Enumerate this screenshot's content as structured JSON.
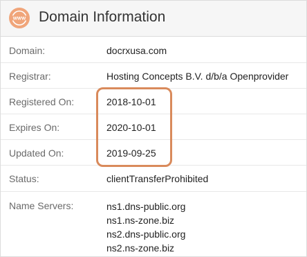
{
  "header": {
    "icon": "www-globe-icon",
    "icon_text": "WWW",
    "title": "Domain Information"
  },
  "rows": [
    {
      "label": "Domain:",
      "value": "docrxusa.com"
    },
    {
      "label": "Registrar:",
      "value": "Hosting Concepts B.V. d/b/a Openprovider"
    },
    {
      "label": "Registered On:",
      "value": "2018-10-01"
    },
    {
      "label": "Expires On:",
      "value": "2020-10-01"
    },
    {
      "label": "Updated On:",
      "value": "2019-09-25"
    },
    {
      "label": "Status:",
      "value": "clientTransferProhibited"
    }
  ],
  "name_servers": {
    "label": "Name Servers:",
    "values": [
      "ns1.dns-public.org",
      "ns1.ns-zone.biz",
      "ns2.dns-public.org",
      "ns2.ns-zone.biz"
    ]
  },
  "colors": {
    "accent": "#d98a5b",
    "icon_bg": "#f0a57a",
    "header_bg": "#f6f6f6"
  }
}
